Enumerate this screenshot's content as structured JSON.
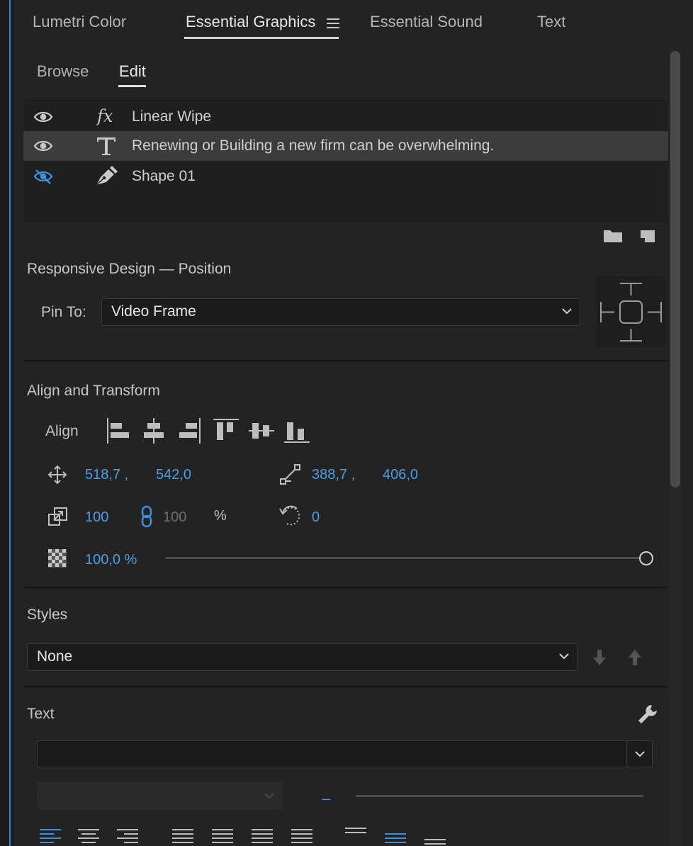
{
  "panel_tabs": [
    {
      "label": "Lumetri Color"
    },
    {
      "label": "Essential Graphics"
    },
    {
      "label": "Essential Sound"
    },
    {
      "label": "Text"
    }
  ],
  "sub_tabs": [
    {
      "label": "Browse"
    },
    {
      "label": "Edit"
    }
  ],
  "layers": [
    {
      "name": "Linear Wipe",
      "type": "fx-icon",
      "visible": true
    },
    {
      "name": "Renewing or Building a new firm can be overwhelming.",
      "type": "text-tool-icon",
      "visible": true,
      "selected": true
    },
    {
      "name": "Shape 01",
      "type": "pen-icon",
      "visible": false
    }
  ],
  "responsive": {
    "title": "Responsive Design — Position",
    "pin_label": "Pin To:",
    "pin_value": "Video Frame"
  },
  "align_transform": {
    "title": "Align and Transform",
    "align_label": "Align",
    "position_x": "518,7 ,",
    "position_y": "542,0",
    "anchor_x": "388,7 ,",
    "anchor_y": "406,0",
    "scale": "100",
    "scale_linked": "100",
    "percent": "%",
    "rotation": "0",
    "opacity": "100,0 %",
    "opacity_value": 100
  },
  "styles": {
    "title": "Styles",
    "value": "None"
  },
  "text": {
    "title": "Text",
    "font_value": "",
    "size_value": "_"
  },
  "colors": {
    "accent": "#4a9ee6",
    "panel_bg": "#232323",
    "list_bg": "#1f1f1f",
    "selected_row": "#3c3c3c"
  }
}
